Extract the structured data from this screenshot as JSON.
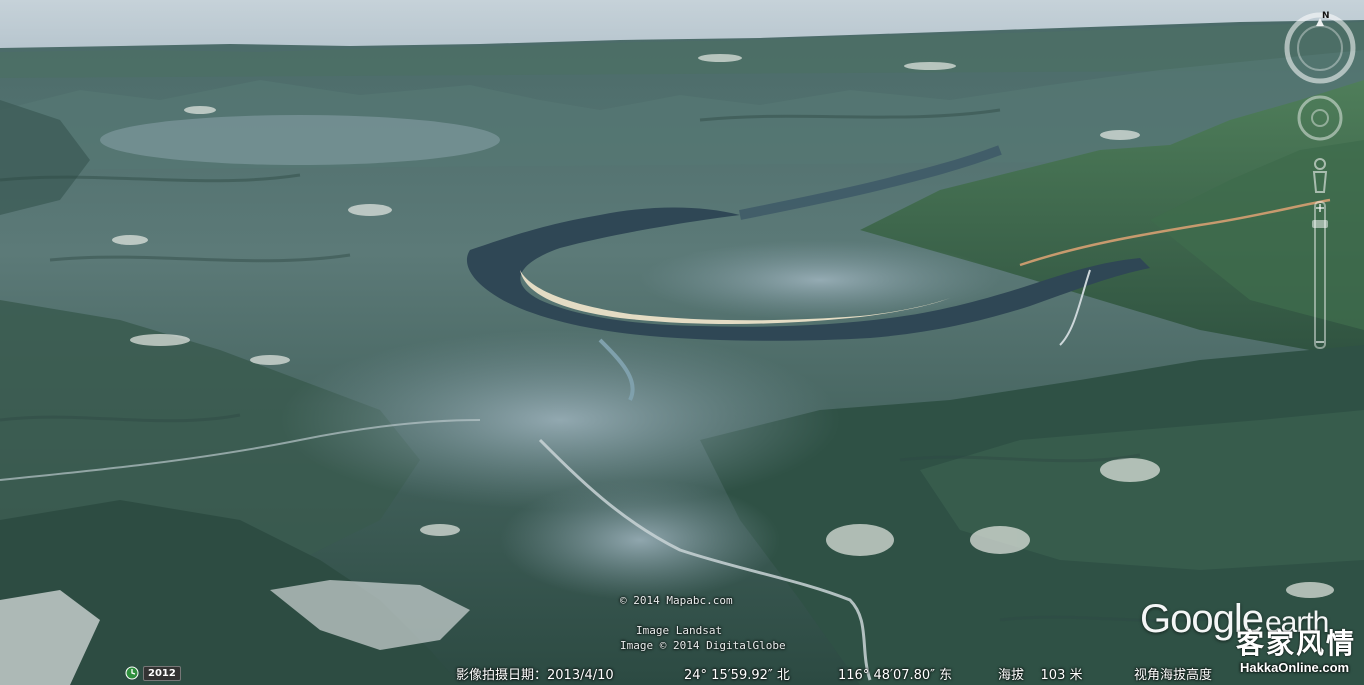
{
  "map": {
    "view": "3D terrain, oblique aerial view of a river valley with mountains",
    "credits": {
      "mapabc": "© 2014 Mapabc.com",
      "landsat": "Image Landsat",
      "globe": "Image © 2014 DigitalGlobe"
    }
  },
  "status_bar": {
    "year": "2012",
    "capture_date": "影像拍摄日期：2013/4/10",
    "latitude": "24° 15′59.92″ 北",
    "longitude": "116° 48′07.80″ 东",
    "elevation": "海拔    103 米",
    "eye_altitude": "视角海拔高度"
  },
  "branding": {
    "google": "Google",
    "earth": "earth",
    "watermark_script": "客家风情",
    "watermark_url": "HakkaOnline.com"
  },
  "navigation": {
    "compass_north": "N",
    "icons": [
      "compass-ring-icon",
      "look-joystick-icon",
      "street-view-pegman-icon",
      "zoom-slider-icon"
    ]
  },
  "colors": {
    "sky": "#b9c7cf",
    "river": "#2f4755",
    "sand": "#e4dcc4"
  }
}
